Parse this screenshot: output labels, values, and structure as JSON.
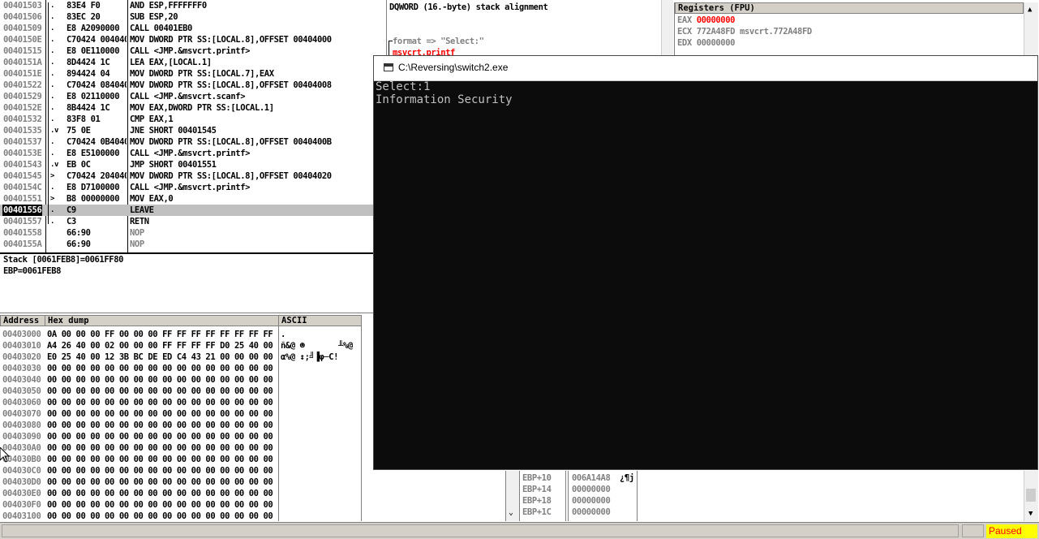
{
  "disasm": {
    "rows": [
      {
        "addr": "00401503",
        "mark": ".",
        "bytes": "83E4 F0",
        "instr": "AND ESP,FFFFFFF0"
      },
      {
        "addr": "00401506",
        "mark": ".",
        "bytes": "83EC 20",
        "instr": "SUB ESP,20"
      },
      {
        "addr": "00401509",
        "mark": ".",
        "bytes": "E8 A2090000",
        "instr": "CALL 00401EB0"
      },
      {
        "addr": "0040150E",
        "mark": ".",
        "bytes": "C70424 004040",
        "instr": "MOV DWORD PTR SS:[LOCAL.8],OFFSET 00404000"
      },
      {
        "addr": "00401515",
        "mark": ".",
        "bytes": "E8 0E110000",
        "instr": "CALL <JMP.&msvcrt.printf>"
      },
      {
        "addr": "0040151A",
        "mark": ".",
        "bytes": "8D4424 1C",
        "instr": "LEA EAX,[LOCAL.1]"
      },
      {
        "addr": "0040151E",
        "mark": ".",
        "bytes": "894424 04",
        "instr": "MOV DWORD PTR SS:[LOCAL.7],EAX"
      },
      {
        "addr": "00401522",
        "mark": ".",
        "bytes": "C70424 084040",
        "instr": "MOV DWORD PTR SS:[LOCAL.8],OFFSET 00404008"
      },
      {
        "addr": "00401529",
        "mark": ".",
        "bytes": "E8 02110000",
        "instr": "CALL <JMP.&msvcrt.scanf>"
      },
      {
        "addr": "0040152E",
        "mark": ".",
        "bytes": "8B4424 1C",
        "instr": "MOV EAX,DWORD PTR SS:[LOCAL.1]"
      },
      {
        "addr": "00401532",
        "mark": ".",
        "bytes": "83F8 01",
        "instr": "CMP EAX,1"
      },
      {
        "addr": "00401535",
        "mark": ".v",
        "bytes": "75 0E",
        "instr": "JNE SHORT 00401545"
      },
      {
        "addr": "00401537",
        "mark": ".",
        "bytes": "C70424 0B4040",
        "instr": "MOV DWORD PTR SS:[LOCAL.8],OFFSET 0040400B"
      },
      {
        "addr": "0040153E",
        "mark": ".",
        "bytes": "E8 E5100000",
        "instr": "CALL <JMP.&msvcrt.printf>"
      },
      {
        "addr": "00401543",
        "mark": ".v",
        "bytes": "EB 0C",
        "instr": "JMP SHORT 00401551"
      },
      {
        "addr": "00401545",
        "mark": ">",
        "bytes": "C70424 204040",
        "instr": "MOV DWORD PTR SS:[LOCAL.8],OFFSET 00404020"
      },
      {
        "addr": "0040154C",
        "mark": ".",
        "bytes": "E8 D7100000",
        "instr": "CALL <JMP.&msvcrt.printf>"
      },
      {
        "addr": "00401551",
        "mark": ">",
        "bytes": "B8 00000000",
        "instr": "MOV EAX,0"
      },
      {
        "addr": "00401556",
        "mark": ".",
        "bytes": "C9",
        "instr": "LEAVE"
      },
      {
        "addr": "00401557",
        "mark": ".",
        "bytes": "C3",
        "instr": "RETN"
      },
      {
        "addr": "00401558",
        "mark": "",
        "bytes": "66:90",
        "instr": "NOP"
      },
      {
        "addr": "0040155A",
        "mark": "",
        "bytes": "66:90",
        "instr": "NOP"
      }
    ],
    "selected_index": 18,
    "comment": "DQWORD (16.-byte) stack alignment",
    "format_label": "format => \"Select:\"",
    "call_label": "msvcrt.printf"
  },
  "info": {
    "line1": "Stack [0061FEB8]=0061FF80",
    "line2": "EBP=0061FEB8"
  },
  "registers": {
    "title": "Registers (FPU)",
    "rows": [
      {
        "name": "EAX",
        "value": "00000000",
        "note": ""
      },
      {
        "name": "ECX",
        "value": "772A48FD",
        "note": "msvcrt.772A48FD"
      },
      {
        "name": "EDX",
        "value": "00000000",
        "note": ""
      }
    ]
  },
  "dump": {
    "headers": {
      "address": "Address",
      "hex": "Hex dump",
      "ascii": "ASCII"
    },
    "rows": [
      {
        "addr": "00403000",
        "hex": "0A 00 00 00 FF 00 00 00 FF FF FF FF FF FF FF FF",
        "ascii": "."
      },
      {
        "addr": "00403010",
        "hex": "A4 26 40 00 02 00 00 00 FF FF FF FF D0 25 40 00",
        "ascii": "ñ&@ ☻       ╨%@"
      },
      {
        "addr": "00403020",
        "hex": "E0 25 40 00 12 3B BC DE ED C4 43 21 00 00 00 00",
        "ascii": "α%@ ↕;╝▐φ─C!"
      },
      {
        "addr": "00403030",
        "hex": "00 00 00 00 00 00 00 00 00 00 00 00 00 00 00 00",
        "ascii": ""
      },
      {
        "addr": "00403040",
        "hex": "00 00 00 00 00 00 00 00 00 00 00 00 00 00 00 00",
        "ascii": ""
      },
      {
        "addr": "00403050",
        "hex": "00 00 00 00 00 00 00 00 00 00 00 00 00 00 00 00",
        "ascii": ""
      },
      {
        "addr": "00403060",
        "hex": "00 00 00 00 00 00 00 00 00 00 00 00 00 00 00 00",
        "ascii": ""
      },
      {
        "addr": "00403070",
        "hex": "00 00 00 00 00 00 00 00 00 00 00 00 00 00 00 00",
        "ascii": ""
      },
      {
        "addr": "00403080",
        "hex": "00 00 00 00 00 00 00 00 00 00 00 00 00 00 00 00",
        "ascii": ""
      },
      {
        "addr": "00403090",
        "hex": "00 00 00 00 00 00 00 00 00 00 00 00 00 00 00 00",
        "ascii": ""
      },
      {
        "addr": "004030A0",
        "hex": "00 00 00 00 00 00 00 00 00 00 00 00 00 00 00 00",
        "ascii": ""
      },
      {
        "addr": "004030B0",
        "hex": "00 00 00 00 00 00 00 00 00 00 00 00 00 00 00 00",
        "ascii": ""
      },
      {
        "addr": "004030C0",
        "hex": "00 00 00 00 00 00 00 00 00 00 00 00 00 00 00 00",
        "ascii": ""
      },
      {
        "addr": "004030D0",
        "hex": "00 00 00 00 00 00 00 00 00 00 00 00 00 00 00 00",
        "ascii": ""
      },
      {
        "addr": "004030E0",
        "hex": "00 00 00 00 00 00 00 00 00 00 00 00 00 00 00 00",
        "ascii": ""
      },
      {
        "addr": "004030F0",
        "hex": "00 00 00 00 00 00 00 00 00 00 00 00 00 00 00 00",
        "ascii": ""
      },
      {
        "addr": "00403100",
        "hex": "00 00 00 00 00 00 00 00 00 00 00 00 00 00 00 00",
        "ascii": ""
      }
    ]
  },
  "stack": {
    "rows": [
      {
        "ref": "EBP+10",
        "value": "006A14A8",
        "note": "¿¶j"
      },
      {
        "ref": "EBP+14",
        "value": "00000000",
        "note": ""
      },
      {
        "ref": "EBP+18",
        "value": "00000000",
        "note": ""
      },
      {
        "ref": "EBP+1C",
        "value": "00000000",
        "note": ""
      }
    ]
  },
  "console": {
    "title": "C:\\Reversing\\switch2.exe",
    "lines": [
      "Select:1",
      "Information Security"
    ]
  },
  "status": {
    "state": "Paused"
  },
  "colors": {
    "paused_bg": "#ffff00",
    "paused_text": "#ff0000",
    "console_bg": "#0c0c0c",
    "reg_changed": "#ff0000"
  }
}
